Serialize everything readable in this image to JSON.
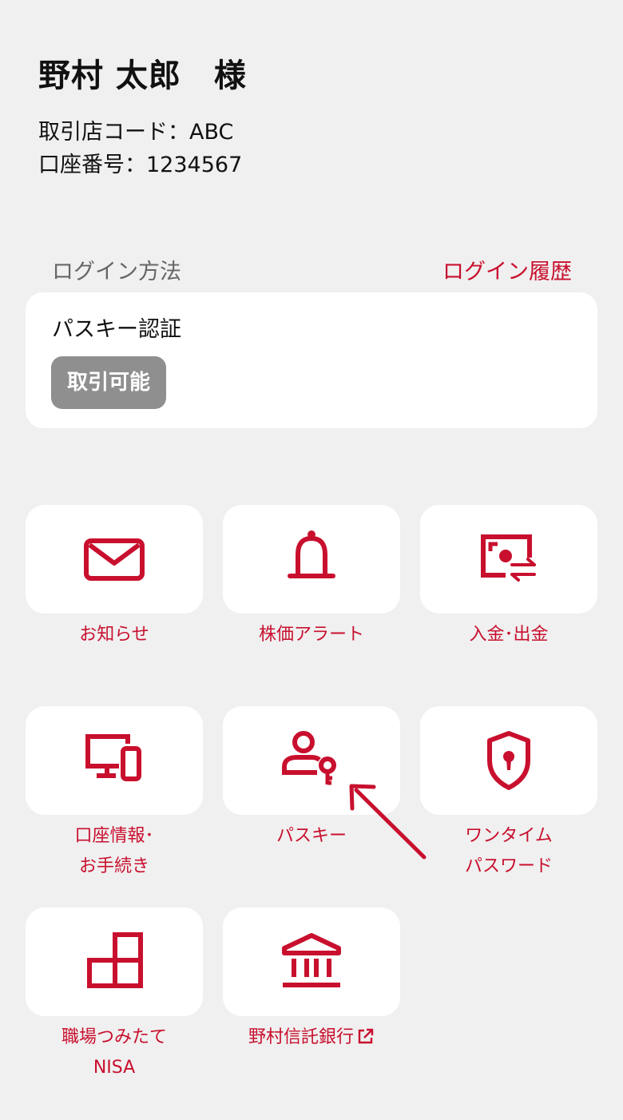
{
  "user": {
    "name": "野村 太郎　様",
    "branch_code": "取引店コード：ABC",
    "account_number": "口座番号：1234567"
  },
  "login": {
    "method_label": "ログイン方法",
    "history_link": "ログイン履歴",
    "auth_name": "パスキー認証",
    "status_badge": "取引可能"
  },
  "menu": {
    "items": [
      {
        "icon": "mail-icon",
        "label_lines": [
          "お知らせ"
        ]
      },
      {
        "icon": "bell-icon",
        "label_lines": [
          "株価アラート"
        ]
      },
      {
        "icon": "deposit-withdraw-icon",
        "label_lines": [
          "入金･出金"
        ]
      },
      {
        "icon": "devices-icon",
        "label_lines": [
          "口座情報･",
          "お手続き"
        ]
      },
      {
        "icon": "passkey-user-icon",
        "label_lines": [
          "パスキー"
        ]
      },
      {
        "icon": "shield-lock-icon",
        "label_lines": [
          "ワンタイム",
          "パスワード"
        ]
      },
      {
        "icon": "blocks-icon",
        "label_lines": [
          "職場つみたて",
          "NISA"
        ]
      },
      {
        "icon": "bank-icon",
        "label_lines": [
          "野村信託銀行"
        ],
        "external_link_icon": "external-link-icon"
      }
    ]
  },
  "colors": {
    "accent": "#c8102e",
    "background": "#f0f0f0",
    "card": "#ffffff",
    "badge": "#8f8f8f"
  },
  "annotation": {
    "arrow_icon": "pointer-arrow-icon",
    "arrow_color": "#c8102e"
  }
}
